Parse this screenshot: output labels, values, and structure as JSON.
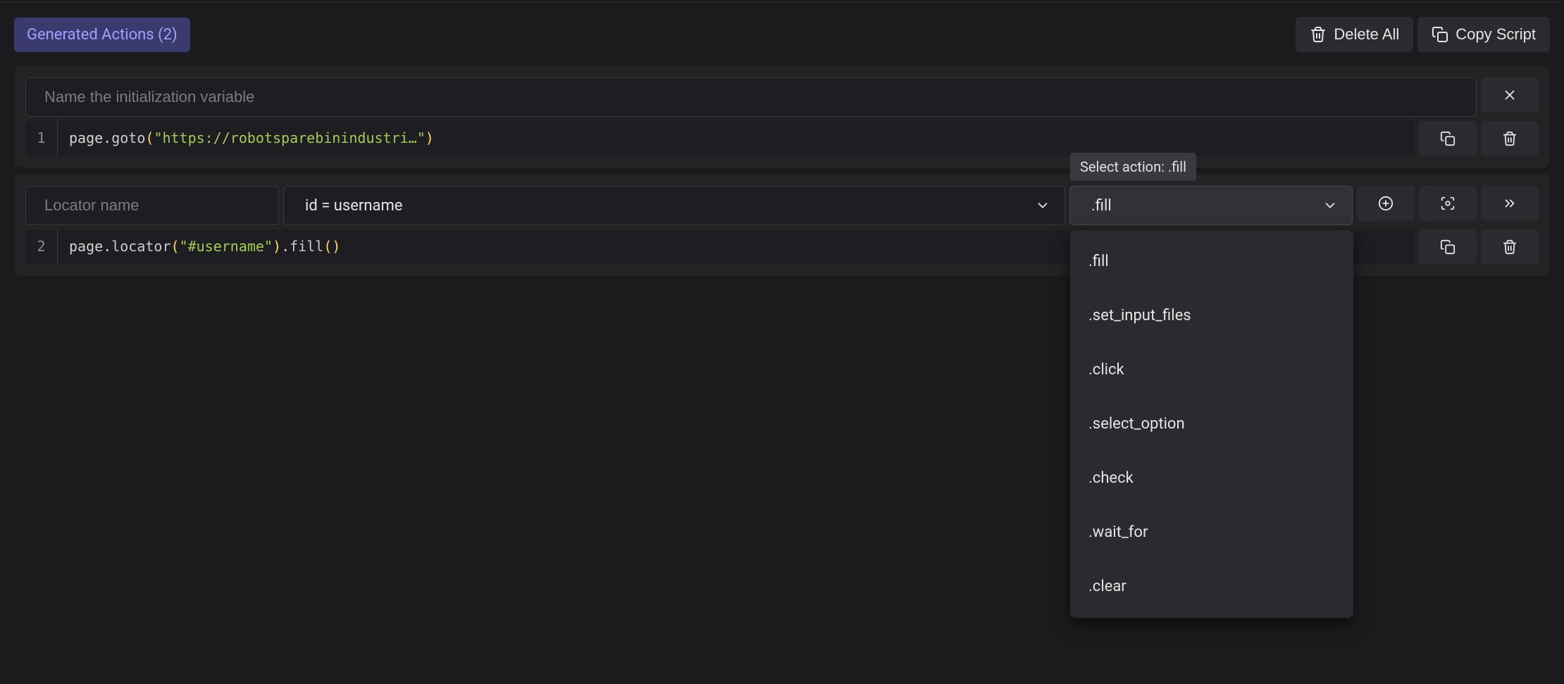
{
  "header": {
    "tab_label": "Generated Actions (2)",
    "delete_all": "Delete All",
    "copy_script": "Copy Script"
  },
  "action1": {
    "name_placeholder": "Name the initialization variable",
    "line_no": "1",
    "code": {
      "obj": "page",
      "fn": "goto",
      "arg": "\"https://robotsparebinindustri…\""
    }
  },
  "action2": {
    "locator_placeholder": "Locator name",
    "selector_text": "id = username",
    "action_value": ".fill",
    "tooltip": "Select action: .fill",
    "options": [
      ".fill",
      ".set_input_files",
      ".click",
      ".select_option",
      ".check",
      ".wait_for",
      ".clear"
    ],
    "line_no": "2",
    "code": {
      "obj": "page",
      "fn1": "locator",
      "arg": "\"#username\"",
      "fn2": "fill"
    }
  }
}
